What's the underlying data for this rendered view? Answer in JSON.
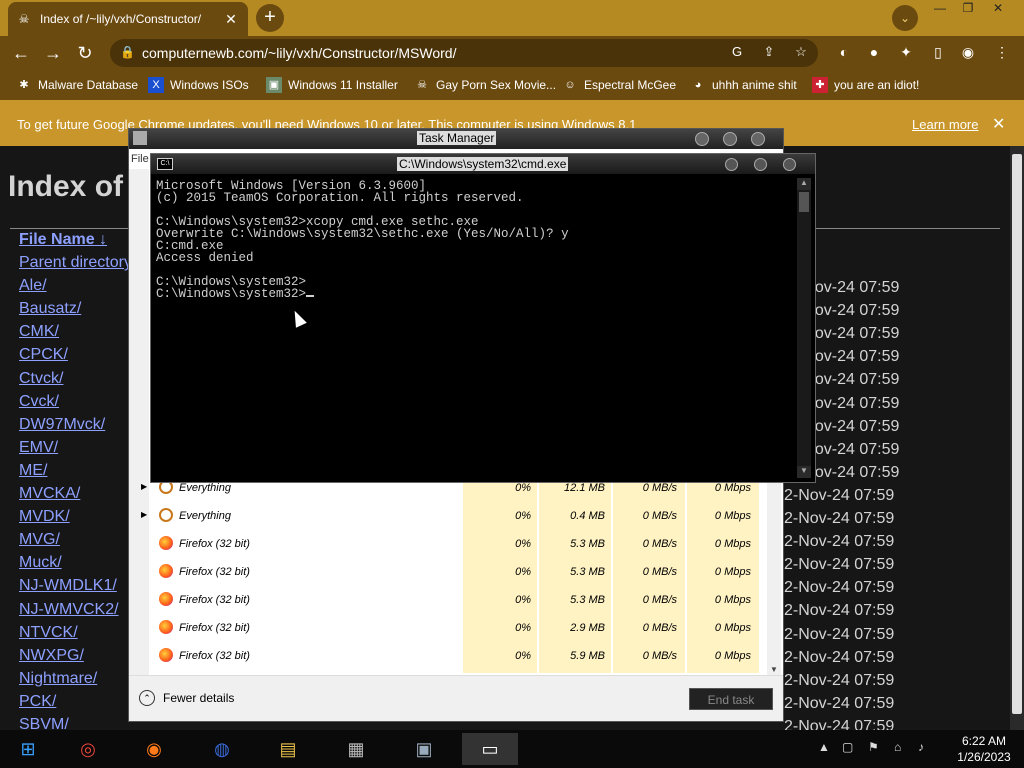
{
  "browser": {
    "tab_title": "Index of /~lily/vxh/Constructor/",
    "url": "computernewb.com/~lily/vxh/Constructor/MSWord/",
    "bookmarks": [
      {
        "label": "Malware Database",
        "icon": "bug-icon"
      },
      {
        "label": "Windows ISOs",
        "icon": "x-icon"
      },
      {
        "label": "Windows 11 Installer",
        "icon": "image-icon"
      },
      {
        "label": "Gay Porn Sex Movie...",
        "icon": "skull-icon"
      },
      {
        "label": "Espectral McGee",
        "icon": "face-icon"
      },
      {
        "label": "uhhh anime shit",
        "icon": "anime-icon"
      },
      {
        "label": "you are an idiot!",
        "icon": "flag-icon"
      }
    ],
    "infobar_message": "To get future Google Chrome updates, you'll need Windows 10 or later. This computer is using Windows 8.1",
    "infobar_link": "Learn more"
  },
  "page": {
    "heading": "Index of",
    "column_header": "File Name",
    "links": [
      "Parent directory",
      "Ale/",
      "Bausatz/",
      "CMK/",
      "CPCK/",
      "Ctvck/",
      "Cvck/",
      "DW97Mvck/",
      "EMV/",
      "ME/",
      "MVCKA/",
      "MVDK/",
      "MVG/",
      "Muck/",
      "NJ-WMDLK1/",
      "NJ-WMVCK2/",
      "NTVCK/",
      "NWXPG/",
      "Nightmare/",
      "PCK/",
      "SBVM/"
    ],
    "dates": [
      "-Nov-24 07:59",
      "-Nov-24 07:59",
      "-Nov-24 07:59",
      "-Nov-24 07:59",
      "-Nov-24 07:59",
      "-Nov-24 07:59",
      "-Nov-24 07:59",
      "-Nov-24 07:59",
      "-Nov-24 07:59",
      "2-Nov-24 07:59",
      "2-Nov-24 07:59",
      "2-Nov-24 07:59",
      "2-Nov-24 07:59",
      "2-Nov-24 07:59",
      "2-Nov-24 07:59",
      "2-Nov-24 07:59",
      "2-Nov-24 07:59",
      "2-Nov-24 07:59",
      "2-Nov-24 07:59",
      "2-Nov-24 07:59"
    ]
  },
  "task_manager": {
    "title": "Task Manager",
    "menu": "File",
    "processes": [
      {
        "name": "Everything",
        "cpu": "0%",
        "mem": "12.1 MB",
        "disk": "0 MB/s",
        "net": "0 Mbps",
        "expand": true,
        "icon": "magnifier-icon"
      },
      {
        "name": "Everything",
        "cpu": "0%",
        "mem": "0.4 MB",
        "disk": "0 MB/s",
        "net": "0 Mbps",
        "expand": true,
        "icon": "magnifier-icon"
      },
      {
        "name": "Firefox (32 bit)",
        "cpu": "0%",
        "mem": "5.3 MB",
        "disk": "0 MB/s",
        "net": "0 Mbps",
        "expand": false,
        "icon": "firefox-icon"
      },
      {
        "name": "Firefox (32 bit)",
        "cpu": "0%",
        "mem": "5.3 MB",
        "disk": "0 MB/s",
        "net": "0 Mbps",
        "expand": false,
        "icon": "firefox-icon"
      },
      {
        "name": "Firefox (32 bit)",
        "cpu": "0%",
        "mem": "5.3 MB",
        "disk": "0 MB/s",
        "net": "0 Mbps",
        "expand": false,
        "icon": "firefox-icon"
      },
      {
        "name": "Firefox (32 bit)",
        "cpu": "0%",
        "mem": "2.9 MB",
        "disk": "0 MB/s",
        "net": "0 Mbps",
        "expand": false,
        "icon": "firefox-icon"
      },
      {
        "name": "Firefox (32 bit)",
        "cpu": "0%",
        "mem": "5.9 MB",
        "disk": "0 MB/s",
        "net": "0 Mbps",
        "expand": false,
        "icon": "firefox-icon"
      }
    ],
    "fewer_details": "Fewer details",
    "end_task": "End task"
  },
  "cmd": {
    "title": "C:\\Windows\\system32\\cmd.exe",
    "lines": [
      "Microsoft Windows [Version 6.3.9600]",
      "(c) 2015 TeamOS Corporation. All rights reserved.",
      "",
      "C:\\Windows\\system32>xcopy cmd.exe sethc.exe",
      "Overwrite C:\\Windows\\system32\\sethc.exe (Yes/No/All)? y",
      "C:cmd.exe",
      "Access denied",
      "",
      "C:\\Windows\\system32>",
      "C:\\Windows\\system32>"
    ]
  },
  "taskbar": {
    "apps": [
      "windows-logo",
      "chrome-icon",
      "firefox-icon",
      "browser-icon",
      "file-explorer-icon",
      "store-icon",
      "monitor-icon",
      "cmd-icon"
    ],
    "time": "6:22 AM",
    "date": "1/26/2023"
  }
}
